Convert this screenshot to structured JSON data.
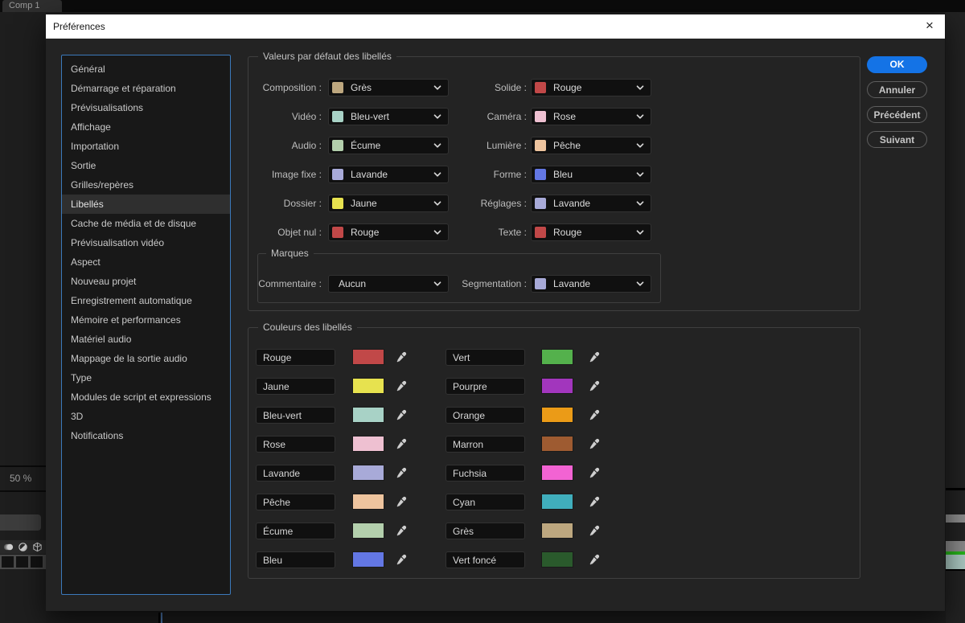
{
  "window": {
    "title": "Préférences",
    "close": "×"
  },
  "background": {
    "comp_tab": "Comp 1",
    "zoom_level": "50 %"
  },
  "sidebar": {
    "items": [
      "Général",
      "Démarrage et réparation",
      "Prévisualisations",
      "Affichage",
      "Importation",
      "Sortie",
      "Grilles/repères",
      "Libellés",
      "Cache de média et de disque",
      "Prévisualisation vidéo",
      "Aspect",
      "Nouveau projet",
      "Enregistrement automatique",
      "Mémoire et performances",
      "Matériel audio",
      "Mappage de la sortie audio",
      "Type",
      "Modules de script et expressions",
      "3D",
      "Notifications"
    ],
    "selected": "Libellés"
  },
  "defaults": {
    "title": "Valeurs par défaut des libellés",
    "left": [
      {
        "label": "Composition :",
        "value": "Grès",
        "color": "#bda77f"
      },
      {
        "label": "Vidéo :",
        "value": "Bleu-vert",
        "color": "#a8d2c6"
      },
      {
        "label": "Audio :",
        "value": "Écume",
        "color": "#b3cfac"
      },
      {
        "label": "Image fixe :",
        "value": "Lavande",
        "color": "#a8aad8"
      },
      {
        "label": "Dossier :",
        "value": "Jaune",
        "color": "#e7e24f"
      },
      {
        "label": "Objet nul :",
        "value": "Rouge",
        "color": "#c14848"
      }
    ],
    "right": [
      {
        "label": "Solide :",
        "value": "Rouge",
        "color": "#c14848"
      },
      {
        "label": "Caméra :",
        "value": "Rose",
        "color": "#eec0d1"
      },
      {
        "label": "Lumière :",
        "value": "Pêche",
        "color": "#eec49e"
      },
      {
        "label": "Forme :",
        "value": "Bleu",
        "color": "#6377e4"
      },
      {
        "label": "Réglages :",
        "value": "Lavande",
        "color": "#a8aad8"
      },
      {
        "label": "Texte :",
        "value": "Rouge",
        "color": "#c14848"
      }
    ]
  },
  "marques": {
    "title": "Marques",
    "comment": {
      "label": "Commentaire :",
      "value": "Aucun"
    },
    "segmentation": {
      "label": "Segmentation :",
      "value": "Lavande",
      "color": "#a8aad8"
    }
  },
  "colors": {
    "title": "Couleurs des libellés",
    "left": [
      {
        "name": "Rouge",
        "color": "#c14848"
      },
      {
        "name": "Jaune",
        "color": "#e7e24f"
      },
      {
        "name": "Bleu-vert",
        "color": "#a8d2c6"
      },
      {
        "name": "Rose",
        "color": "#eec0d1"
      },
      {
        "name": "Lavande",
        "color": "#a8aad8"
      },
      {
        "name": "Pêche",
        "color": "#eec49e"
      },
      {
        "name": "Écume",
        "color": "#b3cfac"
      },
      {
        "name": "Bleu",
        "color": "#6377e4"
      }
    ],
    "right": [
      {
        "name": "Vert",
        "color": "#54b14c"
      },
      {
        "name": "Pourpre",
        "color": "#a236bd"
      },
      {
        "name": "Orange",
        "color": "#eb9b17"
      },
      {
        "name": "Marron",
        "color": "#9e5b31"
      },
      {
        "name": "Fuchsia",
        "color": "#f263d3"
      },
      {
        "name": "Cyan",
        "color": "#40aebc"
      },
      {
        "name": "Grès",
        "color": "#bda77f"
      },
      {
        "name": "Vert foncé",
        "color": "#2a5a2c"
      }
    ]
  },
  "buttons": {
    "ok": "OK",
    "cancel": "Annuler",
    "previous": "Précédent",
    "next": "Suivant"
  },
  "accent": {
    "primary_blue": "#1473e6",
    "panel_border_blue": "#3b79bb"
  }
}
